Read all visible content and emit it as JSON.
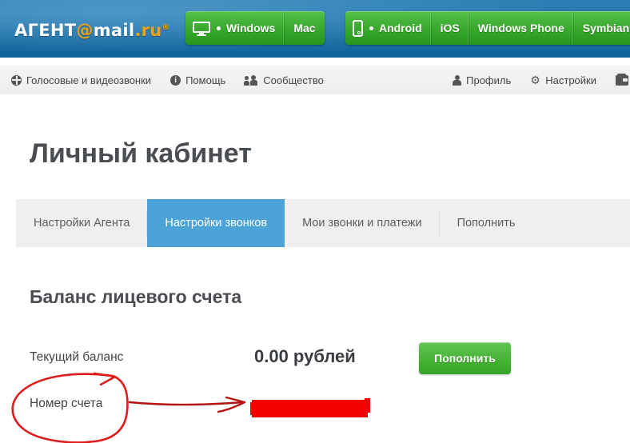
{
  "header": {
    "logo": {
      "part1": "АГЕНТ",
      "at": "@",
      "part2": "mail",
      "part3": ".ru",
      "sup": "®"
    },
    "platform_groups": [
      {
        "name": "desktop",
        "icon": "monitor-icon",
        "items": [
          {
            "label": "Windows",
            "active": true
          },
          {
            "label": "Mac",
            "active": false
          }
        ]
      },
      {
        "name": "mobile",
        "icon": "phone-icon",
        "items": [
          {
            "label": "Android",
            "active": true
          },
          {
            "label": "iOS",
            "active": false
          },
          {
            "label": "Windows Phone",
            "active": false
          },
          {
            "label": "Symbian",
            "active": false
          }
        ]
      }
    ],
    "colors": {
      "blue_top": "#2e7fb5",
      "blue_bottom": "#0d639c",
      "green": "#3fae33",
      "logo_accent": "#f0a30a"
    }
  },
  "navbar": {
    "left": [
      {
        "label": "Голосовые и видеозвонки",
        "icon": "globe-icon"
      },
      {
        "label": "Помощь",
        "icon": "info-icon"
      },
      {
        "label": "Сообщество",
        "icon": "people-icon"
      }
    ],
    "right": [
      {
        "label": "Профиль",
        "icon": "person-icon"
      },
      {
        "label": "Настройки",
        "icon": "gear-icon"
      },
      {
        "label": "",
        "icon": "wallet-icon"
      }
    ]
  },
  "main": {
    "page_title": "Личный кабинет",
    "tabs": [
      {
        "label": "Настройки Агента",
        "active": false
      },
      {
        "label": "Настройки звонков",
        "active": true
      },
      {
        "label": "Мои звонки и платежи",
        "active": false
      },
      {
        "label": "Пополнить",
        "active": false
      }
    ],
    "active_tab_color": "#4ba3d8",
    "section_title": "Баланс лицевого счета",
    "balance": {
      "label": "Текущий баланс",
      "value": "0.00 рублей",
      "button_label": "Пополнить"
    },
    "account": {
      "label": "Номер счета",
      "value_redacted": true
    }
  },
  "annotation": {
    "type": "hand-drawn",
    "color": "#e01b1b",
    "shapes": [
      "ellipse-around-account-label",
      "arrow-to-redacted-value",
      "redaction-block"
    ]
  }
}
